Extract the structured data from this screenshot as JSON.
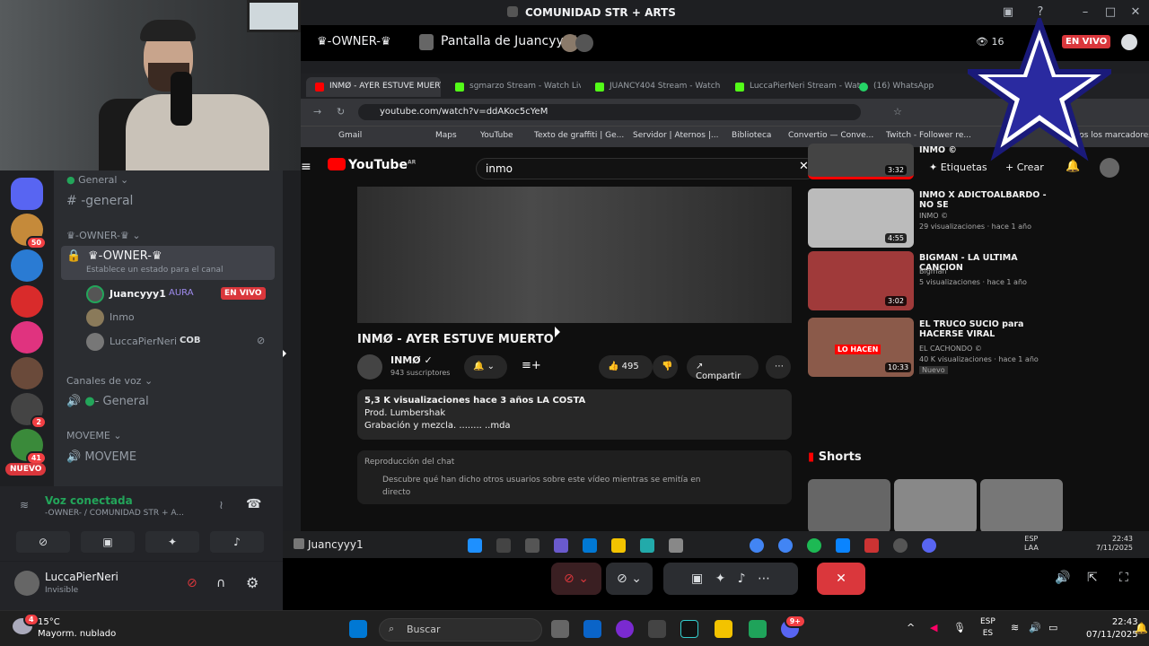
{
  "window": {
    "title": "COMUNIDAD STR + ARTS"
  },
  "stream_header": {
    "channel": "-OWNER-",
    "screen_label": "Pantalla de Juancyyy1",
    "live": "EN VIVO",
    "viewers": "16"
  },
  "browser": {
    "tabs": [
      {
        "label": "INMØ - AYER ESTUVE MUERTO",
        "color": "#ff0000",
        "active": true
      },
      {
        "label": "sgmarzo Stream - Watch Live",
        "color": "#53fc18"
      },
      {
        "label": "JUANCY404 Stream - Watch",
        "color": "#53fc18"
      },
      {
        "label": "LuccaPierNeri Stream - Watch",
        "color": "#53fc18"
      },
      {
        "label": "(16) WhatsApp",
        "color": "#25d366"
      }
    ],
    "url": "youtube.com/watch?v=ddAKoc5cYeM",
    "bookmarks": [
      "Gmail",
      "Maps",
      "YouTube",
      "Texto de graffiti | Ge...",
      "Servidor | Aternos |...",
      "Biblioteca",
      "Convertio — Conve...",
      "Twitch - Follower re...",
      "Todos los marcadores"
    ]
  },
  "youtube": {
    "logo": "YouTube",
    "region": "AR",
    "search_value": "inmo",
    "create_label": "Crear",
    "labels_btn": "Etiquetas",
    "video_title": "INMØ - AYER ESTUVE MUERTO",
    "channel": "INMØ",
    "subscribers": "943 suscriptores",
    "likes": "495",
    "share": "Compartir",
    "desc_line1": "5,3 K visualizaciones  hace 3 años  LA COSTA",
    "desc_line2": "Prod. Lumbershak",
    "desc_line3": "Grabación y mezcla. ........ ..mda",
    "chat_title": "Reproducción del chat",
    "chat_text": "Descubre qué han dicho otros usuarios sobre este vídeo mientras se emitía en directo",
    "recs": [
      {
        "title": "INMO ©",
        "duration": "3:32",
        "sub1": "",
        "sub2": ""
      },
      {
        "title": "INMO X ADICTOALBARDO - NO SE",
        "duration": "4:55",
        "sub1": "INMO ©",
        "sub2": "29 visualizaciones · hace 1 año"
      },
      {
        "title": "BIGMAN - LA ULTIMA CANCION",
        "duration": "3:02",
        "sub1": "Bigman",
        "sub2": "5 visualizaciones · hace 1 año"
      },
      {
        "title": "EL TRUCO SUCIO para HACERSE VIRAL",
        "duration": "10:33",
        "sub1": "EL CACHONDO ©",
        "sub2": "40 K visualizaciones · hace 1 año",
        "tag": "Nuevo",
        "thumb_text": "LO HACEN"
      }
    ],
    "shorts": "Shorts"
  },
  "stream_taskbar": {
    "user": "Juancyyy1",
    "lang1": "ESP",
    "lang2": "LAA",
    "time": "22:43",
    "date": "7/11/2025"
  },
  "discord": {
    "guild_badges": [
      "50",
      "2",
      "41"
    ],
    "new_badge": "NUEVO",
    "cat_general": "General",
    "channel_general": "-general",
    "cat_owner": "-OWNER-",
    "owner_channel": "-OWNER-",
    "owner_status": "Establece un estado para el canal",
    "voice_users": [
      {
        "name": "Juancyyy1",
        "extra": "AURA",
        "badge": "EN VIVO"
      },
      {
        "name": "Inmo"
      },
      {
        "name": "LuccaPierNeri",
        "extra": "COB"
      }
    ],
    "cat_voice": "Canales de voz",
    "voice_general": "- General",
    "cat_moveme": "MOVEME",
    "voice_moveme": "MOVEME",
    "voice_connected": "Voz conectada",
    "voice_location": "-OWNER- / COMUNIDAD STR + A...",
    "user_name": "LuccaPierNeri",
    "user_status": "Invisible"
  },
  "windows": {
    "temp": "15°C",
    "weather": "Mayorm. nublado",
    "weather_badge": "4",
    "search": "Buscar",
    "lang1": "ESP",
    "lang2": "ES",
    "time": "22:43",
    "date": "07/11/2025",
    "discord_badge": "9+"
  },
  "colors": {
    "accent": "#da373c",
    "discord_bg": "#2b2d31",
    "youtube_red": "#ff0000",
    "voice_green": "#23a55a"
  }
}
